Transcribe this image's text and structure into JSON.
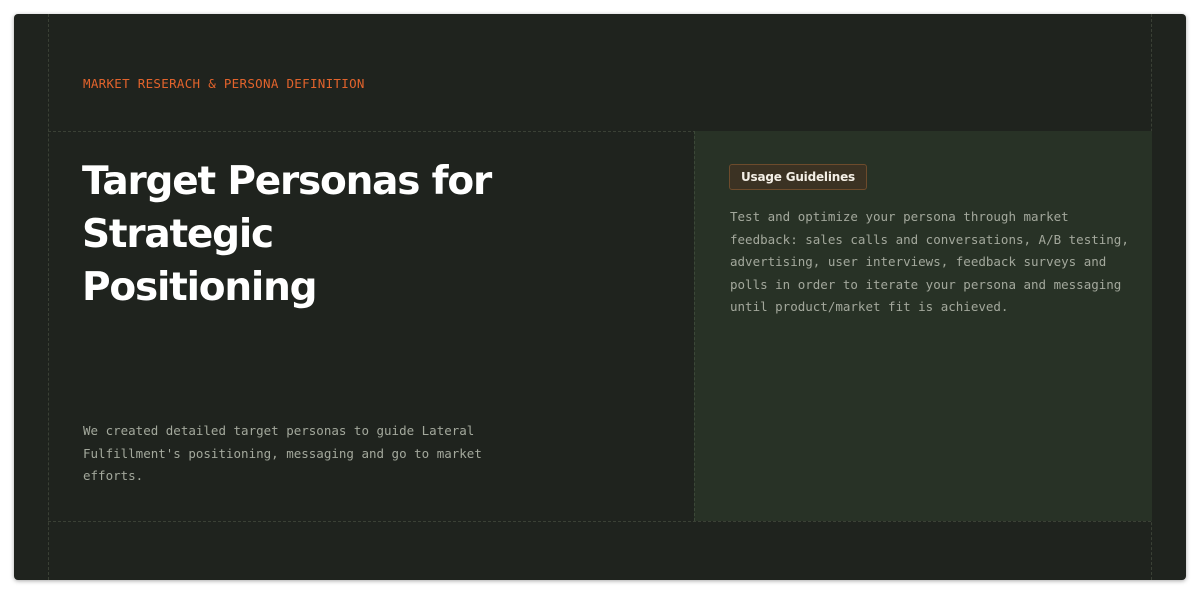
{
  "section": {
    "eyebrow": "MARKET RESERACH & PERSONA DEFINITION",
    "title": "Target Personas for Strategic Positioning",
    "description": "We created detailed target personas to guide Lateral Fulfillment's positioning, messaging and go to market efforts."
  },
  "usage_panel": {
    "badge_label": "Usage Guidelines",
    "body": "Test and optimize your persona through market feedback: sales calls and conversations, A/B testing, advertising, user interviews, feedback surveys and polls in order to iterate your persona and messaging until product/market fit is achieved."
  },
  "colors": {
    "background": "#1f231e",
    "panel_background": "#283226",
    "accent": "#e2632c",
    "title_text": "#ffffff",
    "body_text": "#a3a89c",
    "badge_background": "#3b3223",
    "badge_border": "#6d4b2c"
  }
}
